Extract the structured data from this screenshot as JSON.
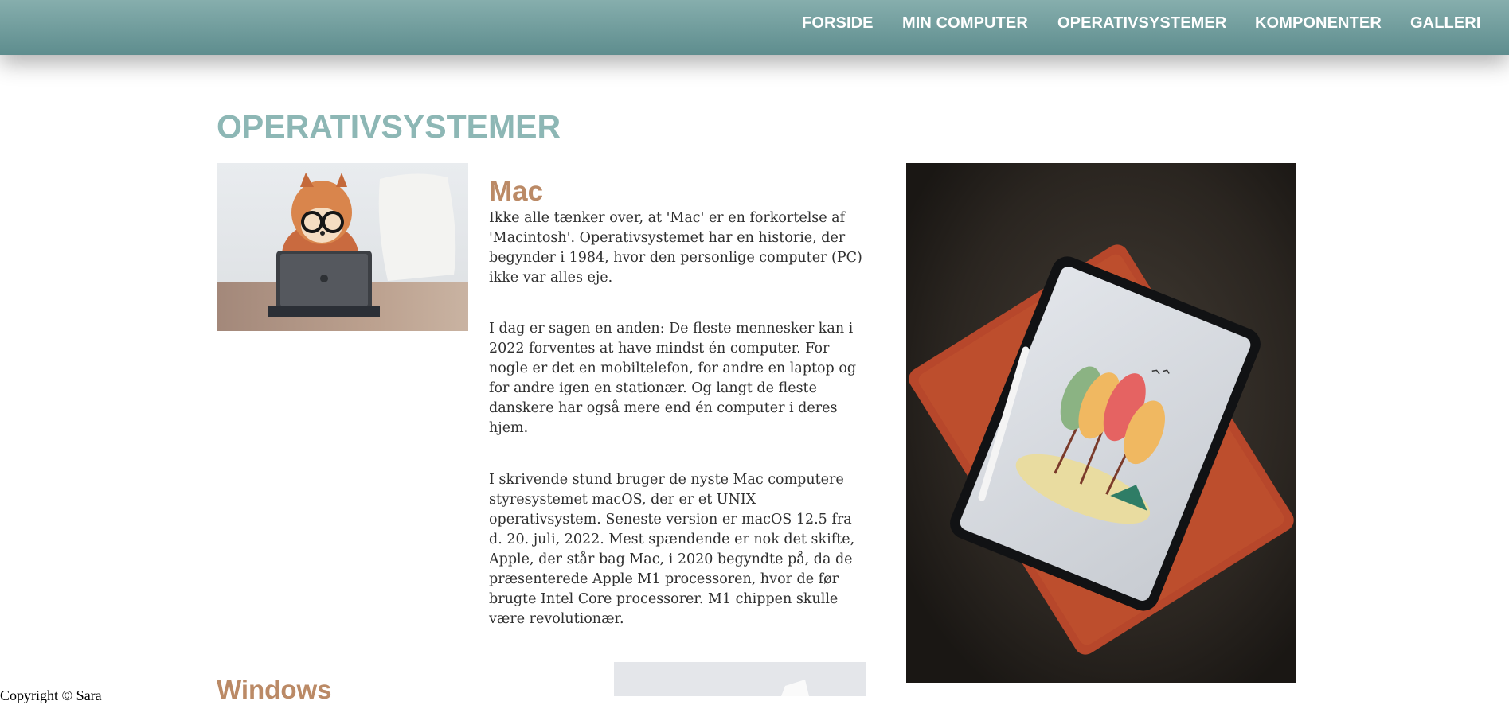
{
  "nav": {
    "items": [
      {
        "label": "FORSIDE"
      },
      {
        "label": "MIN COMPUTER"
      },
      {
        "label": "OPERATIVSYSTEMER"
      },
      {
        "label": "KOMPONENTER"
      },
      {
        "label": "GALLERI"
      }
    ]
  },
  "page": {
    "title": "OPERATIVSYSTEMER"
  },
  "mac": {
    "title": "Mac",
    "paragraphs": [
      "Ikke alle tænker over, at 'Mac' er en forkortelse af 'Macintosh'. Operativsystemet har en historie, der begynder i 1984, hvor den personlige computer (PC) ikke var alles eje.",
      "I dag er sagen en anden: De fleste mennesker kan i 2022 forventes at have mindst én computer. For nogle er det en mobiltelefon, for andre en laptop og for andre igen en stationær. Og langt de fleste danskere har også mere end én computer i deres hjem.",
      "I skrivende stund bruger de nyste Mac computere styresystemet macOS, der er et UNIX operativsystem. Seneste version er macOS 12.5 fra d. 20. juli, 2022. Mest spændende er nok det skifte, Apple, der står bag Mac, i 2020 begyndte på, da de præsenterede Apple M1 processoren, hvor de før brugte Intel Core processorer. M1 chippen skulle være revolutionær."
    ]
  },
  "windows": {
    "title": "Windows"
  },
  "footer": {
    "text": "Copyright © Sara"
  }
}
